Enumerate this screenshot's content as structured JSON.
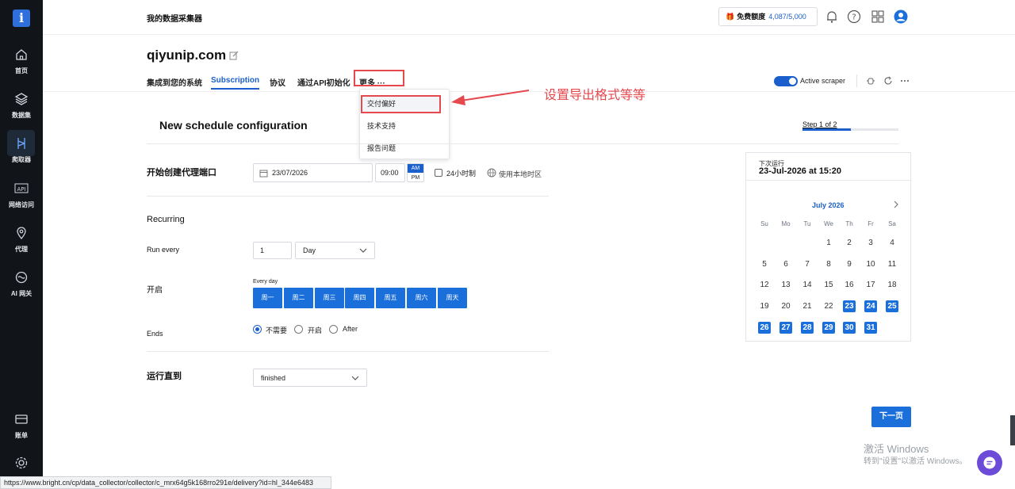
{
  "sidebar": {
    "items": [
      {
        "label": "首页",
        "icon": "home-icon"
      },
      {
        "label": "数据集",
        "icon": "layers-icon"
      },
      {
        "label": "爬取器",
        "icon": "scraper-icon"
      },
      {
        "label": "网络访问",
        "icon": "api-icon"
      },
      {
        "label": "代理",
        "icon": "location-pin-icon"
      },
      {
        "label": "AI 网关",
        "icon": "ai-gateway-icon"
      },
      {
        "label": "账单",
        "icon": "billing-icon"
      }
    ]
  },
  "header": {
    "title": "我的数据采集器",
    "quota_label": "免费额度",
    "quota_value": "4,087/5,000"
  },
  "page": {
    "site_title": "qiyunip.com",
    "tabs": [
      {
        "label": "集成到您的系统"
      },
      {
        "label": "Subscription"
      },
      {
        "label": "协议"
      },
      {
        "label": "通过API初始化"
      },
      {
        "label": "更多 ···"
      }
    ],
    "active_scraper_label": "Active scraper"
  },
  "dropdown": {
    "items": [
      {
        "label": "交付偏好"
      },
      {
        "label": "技术支持"
      },
      {
        "label": "报告问题"
      }
    ]
  },
  "annotation": {
    "text": "设置导出格式等等",
    "color": "#e5484d"
  },
  "config": {
    "title": "New schedule configuration",
    "step_label": "Step 1 of 2",
    "step_progress": 0.5,
    "start_label": "开始创建代理端口",
    "start_date": "23/07/2026",
    "start_time": "09:00",
    "am": "AM",
    "pm": "PM",
    "hour24_label": "24小时制",
    "local_tz_label": "使用本地时区",
    "recurring_label": "Recurring",
    "run_every_label": "Run every",
    "run_every_value": "1",
    "run_every_unit": "Day",
    "enable_label": "开启",
    "every_day_label": "Every day",
    "days": [
      "周一",
      "周二",
      "周三",
      "周四",
      "周五",
      "周六",
      "周天"
    ],
    "ends_label": "Ends",
    "ends_options": [
      "不需要",
      "开启",
      "After"
    ],
    "run_until_label": "运行直到",
    "run_until_value": "finished"
  },
  "calendar": {
    "next_run_label": "下次运行",
    "next_run_value": "23-Jul-2026 at 15:20",
    "month": "July 2026",
    "weekdays": [
      "Su",
      "Mo",
      "Tu",
      "We",
      "Th",
      "Fr",
      "Sa"
    ],
    "weeks": [
      [
        "",
        "",
        "",
        "1",
        "2",
        "3",
        "4"
      ],
      [
        "5",
        "6",
        "7",
        "8",
        "9",
        "10",
        "11"
      ],
      [
        "12",
        "13",
        "14",
        "15",
        "16",
        "17",
        "18"
      ],
      [
        "19",
        "20",
        "21",
        "22",
        "23",
        "24",
        "25"
      ],
      [
        "26",
        "27",
        "28",
        "29",
        "30",
        "31",
        ""
      ]
    ],
    "highlighted": [
      "23",
      "24",
      "25",
      "26",
      "27",
      "28",
      "29",
      "30",
      "31"
    ]
  },
  "next_button": "下一页",
  "windows_watermark": {
    "line1": "激活 Windows",
    "line2": "转到\"设置\"以激活 Windows。"
  },
  "status_url": "https://www.bright.cn/cp/data_collector/collector/c_mrx64g5k168rro291e/delivery?id=hl_344e6483"
}
